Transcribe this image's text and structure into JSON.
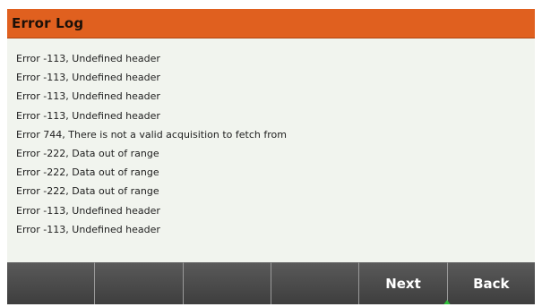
{
  "header": {
    "title": "Error Log"
  },
  "errors": [
    "Error -113, Undefined header",
    "Error -113, Undefined header",
    "Error -113, Undefined header",
    "Error -113, Undefined header",
    "Error 744, There is not a valid acquisition to fetch from",
    "Error -222, Data out of range",
    "Error -222, Data out of range",
    "Error -222, Data out of range",
    "Error -113, Undefined header",
    "Error -113, Undefined header"
  ],
  "softkeys": [
    "",
    "",
    "",
    "",
    "Next",
    "Back"
  ],
  "colors": {
    "title_bar": "#e0601f",
    "background": "#f1f4ee",
    "softkey": "#4a4a4a",
    "focus_indicator": "#2fbf3a"
  },
  "icons": {
    "focus_indicator": "up-arrow-icon"
  }
}
